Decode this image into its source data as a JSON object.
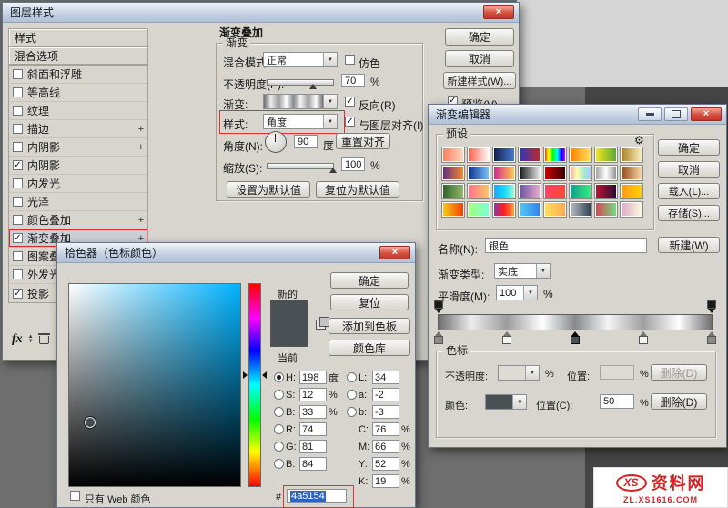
{
  "window": {
    "close_icon": "×",
    "check_icon": "✓",
    "dropdown_arrow_icon": "▼",
    "plus_icon": "+",
    "gear_icon": "⚙"
  },
  "layer_style": {
    "title": "图层样式",
    "styles_header": "样式",
    "blending_options": "混合选项",
    "style_items": [
      {
        "label": "斜面和浮雕",
        "checked": false
      },
      {
        "label": "等高线",
        "checked": false
      },
      {
        "label": "纹理",
        "checked": false
      },
      {
        "label": "描边",
        "checked": false,
        "plus": true
      },
      {
        "label": "内阴影",
        "checked": false,
        "plus": true
      },
      {
        "label": "内阴影",
        "checked": true
      },
      {
        "label": "内发光",
        "checked": false
      },
      {
        "label": "光泽",
        "checked": false
      },
      {
        "label": "颜色叠加",
        "checked": false,
        "plus": true
      },
      {
        "label": "渐变叠加",
        "checked": true,
        "plus": true,
        "selected": true
      },
      {
        "label": "图案叠加",
        "checked": false
      },
      {
        "label": "外发光",
        "checked": false
      },
      {
        "label": "投影",
        "checked": true,
        "plus": true
      }
    ],
    "fx_label": "fx",
    "section_title": "渐变叠加",
    "group_title": "渐变",
    "blend_mode_label": "混合模式:",
    "blend_mode_value": "正常",
    "dither_label": "仿色",
    "opacity_label": "不透明度(P):",
    "opacity_value": "70",
    "opacity_unit": "%",
    "gradient_label": "渐变:",
    "reverse_label": "反向(R)",
    "style_label": "样式:",
    "style_value": "角度",
    "align_label": "与图层对齐(I)",
    "angle_label": "角度(N):",
    "angle_value": "90",
    "angle_unit": "度",
    "reset_align_button": "重置对齐",
    "scale_label": "缩放(S):",
    "scale_value": "100",
    "scale_unit": "%",
    "set_default_button": "设置为默认值",
    "reset_default_button": "复位为默认值",
    "ok_button": "确定",
    "cancel_button": "取消",
    "new_style_button": "新建样式(W)...",
    "preview_label": "预览(V)"
  },
  "gradient_editor": {
    "title": "渐变编辑器",
    "presets_label": "预设",
    "ok_button": "确定",
    "cancel_button": "取消",
    "load_button": "载入(L)...",
    "save_button": "存储(S)...",
    "name_label": "名称(N):",
    "name_value": "银色",
    "new_button": "新建(W)",
    "type_label": "渐变类型:",
    "type_value": "实底",
    "smoothness_label": "平滑度(M):",
    "smoothness_value": "100",
    "smoothness_unit": "%",
    "stops_label": "色标",
    "stop_opacity_label": "不透明度:",
    "stop_opacity_unit": "%",
    "stop_position_label": "位置:",
    "stop_position_unit": "%",
    "delete_button": "删除(D)",
    "color_label": "颜色:",
    "color_position_label": "位置(C):",
    "color_position_value": "50",
    "gradient_css": "linear-gradient(90deg,#6e6e6e 0%,#ececec 12%,#9c9c9c 25%,#ffffff 38%,#87898c 50%,#f4f4f4 62%,#a0a0a0 75%,#ffffff 88%,#707070 100%)",
    "presets": [
      "linear-gradient(90deg,#ff7a5c,#ffd9c2)",
      "linear-gradient(90deg,#ff5b47,#ffffff)",
      "linear-gradient(90deg,#0d1b4c,#4e7fd0)",
      "linear-gradient(90deg,#2638c4,#c42626)",
      "linear-gradient(90deg,#ff0000,#ffff00,#00ff00,#00ffff,#0000ff,#ff00ff)",
      "linear-gradient(90deg,#ff7c00,#ffe65c)",
      "linear-gradient(90deg,#f8e71c,#57a639)",
      "linear-gradient(90deg,#a67c1b,#fff3c4)",
      "linear-gradient(90deg,#5a2d82,#ff8c2e)",
      "linear-gradient(90deg,#0b2a8a,#7ec8ff)",
      "linear-gradient(90deg,#d02090,#ffd24c)",
      "linear-gradient(90deg,#101010,#efefef)",
      "linear-gradient(90deg,#d40000,#2b0000)",
      "linear-gradient(90deg,#ff9aa2,#fdffab,#a8e6cf,#a8c6ff)",
      "linear-gradient(90deg,#9c9c9c,#ffffff,#8a8a8a)",
      "linear-gradient(90deg,#8b4513,#ffdead)",
      "linear-gradient(90deg,#2c5f2d,#97bc62)",
      "linear-gradient(90deg,#ff6f91,#ffc75f)",
      "linear-gradient(90deg,#1fa2ff,#12d8fa,#a6ffcb)",
      "linear-gradient(90deg,#654ea3,#eaafc8)",
      "linear-gradient(90deg,#ff416c,#ff4b2b)",
      "linear-gradient(90deg,#11998e,#38ef7d)",
      "linear-gradient(90deg,#c31432,#240b36)",
      "linear-gradient(90deg,#f7971e,#ffd200)",
      "linear-gradient(90deg,#f5d020,#f53803)",
      "linear-gradient(90deg,#a8ff78,#78ffd6)",
      "linear-gradient(90deg,#833ab4,#fd1d1d,#fcb045)",
      "linear-gradient(90deg,#56ccf2,#2f80ed)",
      "linear-gradient(90deg,#ffe259,#ffa751)",
      "linear-gradient(90deg,#bdc3c7,#2c3e50)",
      "linear-gradient(90deg,#dd3e54,#6be585)",
      "linear-gradient(90deg,#d9a7c7,#fffcdc)"
    ],
    "opacity_stops": [
      {
        "pos": 0
      },
      {
        "pos": 100
      }
    ],
    "color_stops": [
      {
        "pos": 0,
        "color": "#8a8a8a"
      },
      {
        "pos": 25,
        "color": "#f2f2f2"
      },
      {
        "pos": 50,
        "color": "#4a5154",
        "selected": true
      },
      {
        "pos": 75,
        "color": "#f2f2f2"
      },
      {
        "pos": 100,
        "color": "#8a8a8a"
      }
    ]
  },
  "color_picker": {
    "title": "拾色器（色标颜色）",
    "new_label": "新的",
    "current_label": "当前",
    "ok_button": "确定",
    "reset_button": "复位",
    "add_swatch_button": "添加到色板",
    "libraries_button": "颜色库",
    "current_color": "#4a5154",
    "hue": 198,
    "rows_left": [
      {
        "radio": true,
        "selected": true,
        "label": "H:",
        "value": "198",
        "unit": "度"
      },
      {
        "radio": true,
        "label": "S:",
        "value": "12",
        "unit": "%"
      },
      {
        "radio": true,
        "label": "B:",
        "value": "33",
        "unit": "%"
      },
      {
        "radio": true,
        "label": "R:",
        "value": "74",
        "unit": ""
      },
      {
        "radio": true,
        "label": "G:",
        "value": "81",
        "unit": ""
      },
      {
        "radio": true,
        "label": "B:",
        "value": "84",
        "unit": ""
      }
    ],
    "rows_right": [
      {
        "radio": true,
        "label": "L:",
        "value": "34",
        "unit": ""
      },
      {
        "radio": true,
        "label": "a:",
        "value": "-2",
        "unit": ""
      },
      {
        "radio": true,
        "label": "b:",
        "value": "-3",
        "unit": ""
      },
      {
        "radio": false,
        "label": "C:",
        "value": "76",
        "unit": "%"
      },
      {
        "radio": false,
        "label": "M:",
        "value": "66",
        "unit": "%"
      },
      {
        "radio": false,
        "label": "Y:",
        "value": "52",
        "unit": "%"
      },
      {
        "radio": false,
        "label": "K:",
        "value": "19",
        "unit": "%"
      }
    ],
    "web_only_label": "只有 Web 颜色",
    "hex_prefix": "#",
    "hex_value": "4a5154"
  },
  "watermark": {
    "logo_text": "XS",
    "site_name": "资料网",
    "site_url": "ZL.XS1616.COM",
    "accent_color": "#d42323"
  }
}
